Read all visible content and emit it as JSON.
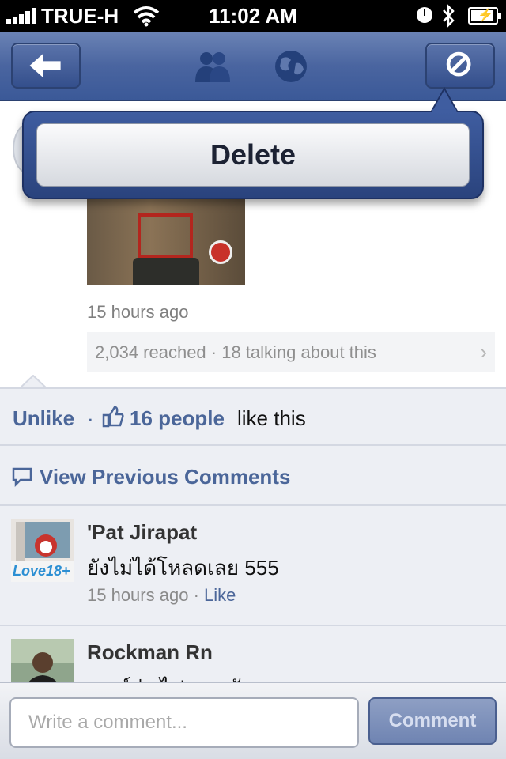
{
  "status_bar": {
    "carrier": "TRUE-H",
    "time": "11:02 AM"
  },
  "navbar": {
    "icons": [
      "back-arrow-icon",
      "friends-icon",
      "globe-icon",
      "block-icon"
    ]
  },
  "post": {
    "time": "15 hours ago",
    "reach": "2,034 reached · 18 talking about this"
  },
  "popover": {
    "delete_label": "Delete"
  },
  "feedback": {
    "unlike_label": "Unlike",
    "separator": "·",
    "like_count": "16 people",
    "like_suffix": "like this",
    "view_previous": "View Previous Comments"
  },
  "comments": [
    {
      "name": "'Pat Jirapat",
      "text": "ยังไม่ได้โหลดเลย 555",
      "time": "15 hours ago",
      "like_label": "Like",
      "avatar_text": "Love18+"
    },
    {
      "name": "Rockman Rn",
      "text": "เจนร์ว่า ไฟเยอะดับ",
      "time": "",
      "like_label": ""
    }
  ],
  "composer": {
    "placeholder": "Write a comment...",
    "button_label": "Comment"
  },
  "colors": {
    "brand": "#3b5998",
    "link": "#4b6699",
    "feedback_bg": "#edeff4"
  }
}
